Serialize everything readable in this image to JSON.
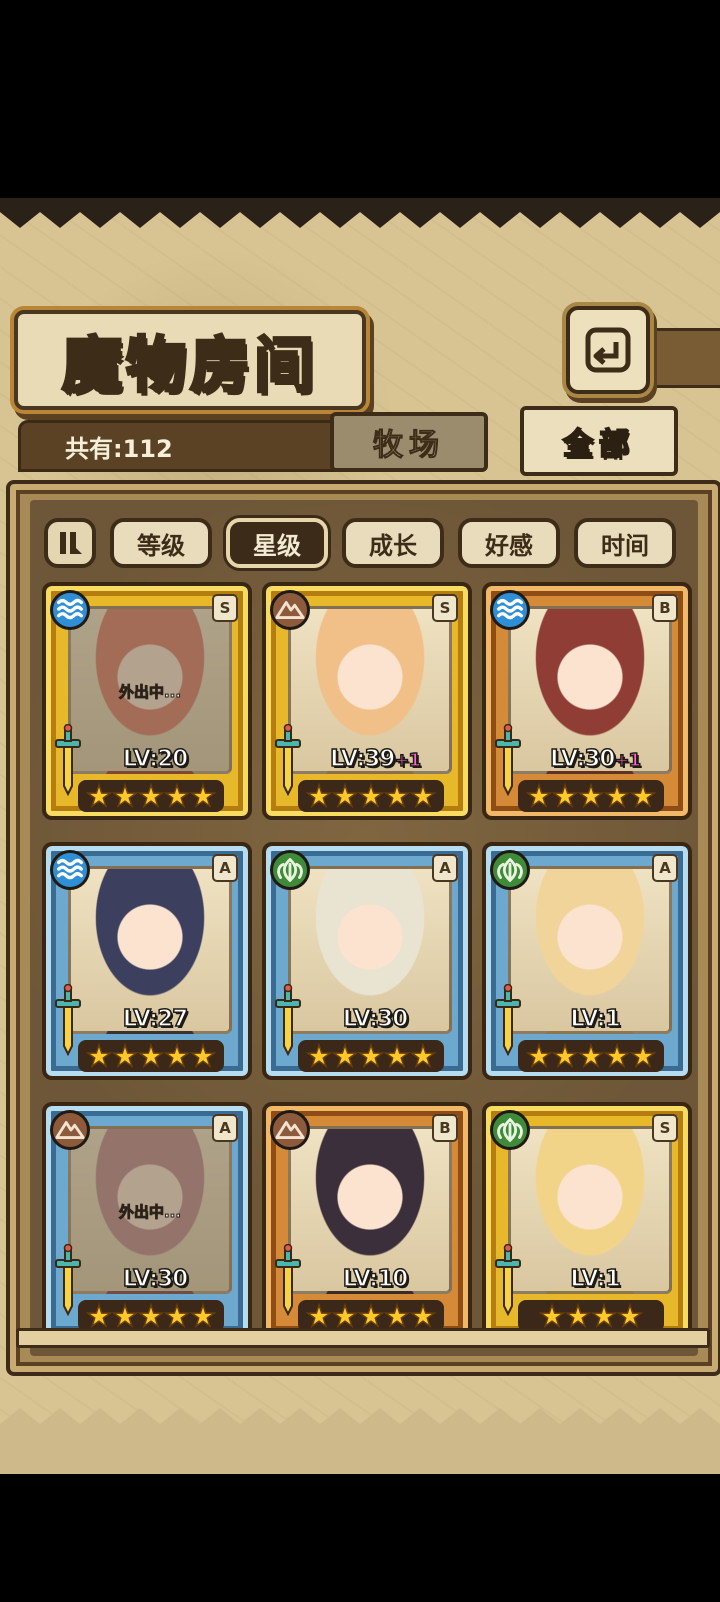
{
  "header": {
    "title": "魔物房间",
    "back_icon": "return-arrow-icon"
  },
  "count": {
    "label": "共有:112"
  },
  "tabs": [
    {
      "label": "牧场",
      "active": false
    },
    {
      "label": "全部",
      "active": true
    }
  ],
  "sort": {
    "toggle_icon": "pause-sort-icon",
    "buttons": [
      {
        "label": "等级",
        "active": false
      },
      {
        "label": "星级",
        "active": true
      },
      {
        "label": "成长",
        "active": false
      },
      {
        "label": "好感",
        "active": false
      },
      {
        "label": "时间",
        "active": false
      }
    ]
  },
  "monsters": [
    {
      "frame": "gold",
      "element": "water",
      "rank": "S",
      "level": "LV:20",
      "bonus": "",
      "stars": 5,
      "away": "外出中...",
      "portrait_color": "#d46b56"
    },
    {
      "frame": "gold",
      "element": "earth",
      "rank": "S",
      "level": "LV:39",
      "bonus": "+1",
      "stars": 5,
      "away": "",
      "portrait_color": "#f1c089"
    },
    {
      "frame": "bronze",
      "element": "water",
      "rank": "B",
      "level": "LV:30",
      "bonus": "+1",
      "stars": 5,
      "away": "",
      "portrait_color": "#8f3d35"
    },
    {
      "frame": "blue",
      "element": "water",
      "rank": "A",
      "level": "LV:27",
      "bonus": "",
      "stars": 5,
      "away": "",
      "portrait_color": "#3d3f5f"
    },
    {
      "frame": "blue",
      "element": "wood",
      "rank": "A",
      "level": "LV:30",
      "bonus": "",
      "stars": 5,
      "away": "",
      "portrait_color": "#e9e3d2"
    },
    {
      "frame": "blue",
      "element": "wood",
      "rank": "A",
      "level": "LV:1",
      "bonus": "",
      "stars": 5,
      "away": "",
      "portrait_color": "#f0d49a"
    },
    {
      "frame": "blue",
      "element": "earth",
      "rank": "A",
      "level": "LV:30",
      "bonus": "",
      "stars": 5,
      "away": "外出中...",
      "portrait_color": "#b77a82"
    },
    {
      "frame": "bronze",
      "element": "earth",
      "rank": "B",
      "level": "LV:10",
      "bonus": "",
      "stars": 5,
      "away": "",
      "portrait_color": "#3a2f3a"
    },
    {
      "frame": "gold",
      "element": "wood",
      "rank": "S",
      "level": "LV:1",
      "bonus": "",
      "stars": 4,
      "away": "",
      "portrait_color": "#f2d489"
    }
  ],
  "colors": {
    "water": "#2f8fd6",
    "earth": "#8d5a3c",
    "wood": "#3f8b3a",
    "star": "#ffc92a",
    "bonus": "#ff66d8"
  }
}
